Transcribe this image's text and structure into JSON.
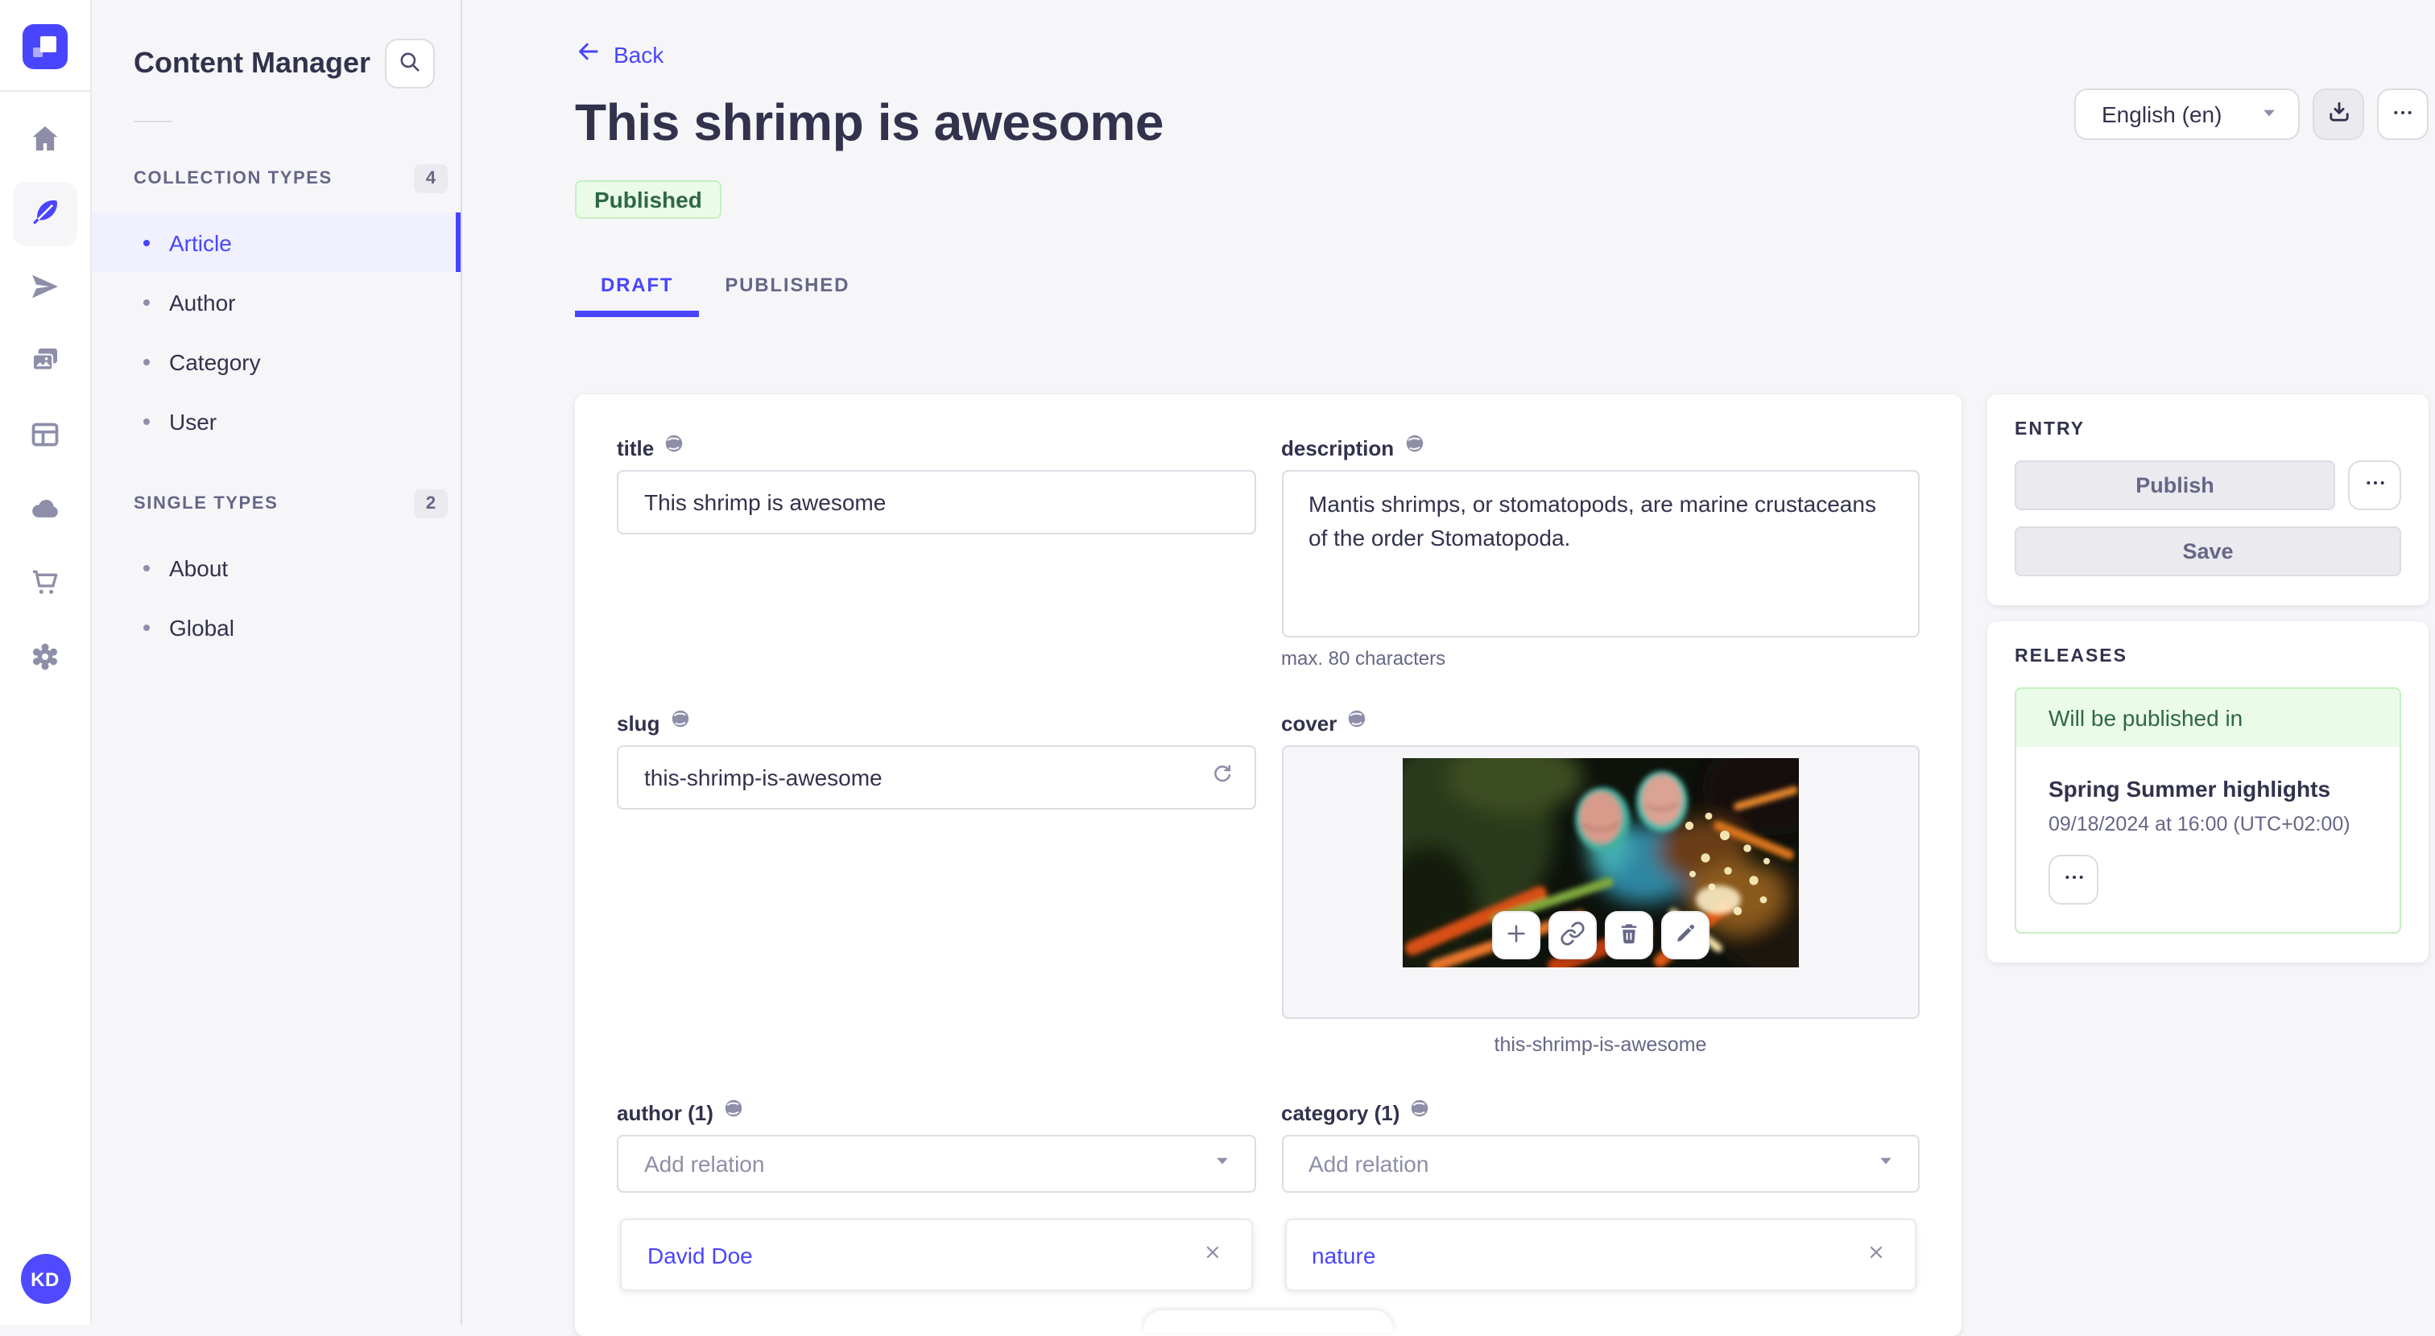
{
  "sidebar": {
    "avatar_initials": "KD",
    "icons": [
      "home-icon",
      "feather-icon",
      "paper-plane-icon",
      "media-library-icon",
      "layout-icon",
      "cloud-icon",
      "cart-icon",
      "gear-icon"
    ]
  },
  "subnav": {
    "title": "Content Manager",
    "sections": [
      {
        "label": "COLLECTION TYPES",
        "count": "4",
        "items": [
          {
            "label": "Article",
            "active": true
          },
          {
            "label": "Author",
            "active": false
          },
          {
            "label": "Category",
            "active": false
          },
          {
            "label": "User",
            "active": false
          }
        ]
      },
      {
        "label": "SINGLE TYPES",
        "count": "2",
        "items": [
          {
            "label": "About",
            "active": false
          },
          {
            "label": "Global",
            "active": false
          }
        ]
      }
    ]
  },
  "header": {
    "back_label": "Back",
    "title": "This shrimp is awesome",
    "status_badge": "Published",
    "locale_select": "English (en)"
  },
  "tabs": {
    "draft": "DRAFT",
    "published": "PUBLISHED"
  },
  "form": {
    "title": {
      "label": "title",
      "value": "This shrimp is awesome"
    },
    "description": {
      "label": "description",
      "value": "Mantis shrimps, or stomatopods, are marine crustaceans of the order Stomatopoda.",
      "helper": "max. 80 characters"
    },
    "slug": {
      "label": "slug",
      "value": "this-shrimp-is-awesome"
    },
    "cover": {
      "label": "cover",
      "caption": "this-shrimp-is-awesome"
    },
    "author": {
      "label": "author (1)",
      "placeholder": "Add relation",
      "relations": [
        {
          "label": "David Doe"
        }
      ]
    },
    "category": {
      "label": "category (1)",
      "placeholder": "Add relation",
      "relations": [
        {
          "label": "nature"
        }
      ]
    }
  },
  "entry_panel": {
    "heading": "ENTRY",
    "publish_label": "Publish",
    "save_label": "Save"
  },
  "releases_panel": {
    "heading": "RELEASES",
    "status": "Will be published in",
    "release_title": "Spring Summer highlights",
    "release_date": "09/18/2024 at 16:00 (UTC+02:00)"
  },
  "icons": {
    "header": [
      "download-icon",
      "more-horizontal-icon"
    ],
    "cover_actions": [
      "plus-icon",
      "link-icon",
      "trash-icon",
      "pencil-icon"
    ],
    "misc": [
      "search-icon",
      "globe-icon",
      "refresh-icon",
      "close-icon",
      "caret-down-icon",
      "back-arrow-icon"
    ]
  },
  "colors": {
    "primary": "#4945ff",
    "primary_light": "#f0f0ff",
    "success_text": "#2f6846",
    "success_bg": "#eafbe7",
    "success_border": "#c6f0c2",
    "text": "#32324d",
    "text_muted": "#666687",
    "border": "#dcdce4",
    "background": "#f6f6f9"
  }
}
